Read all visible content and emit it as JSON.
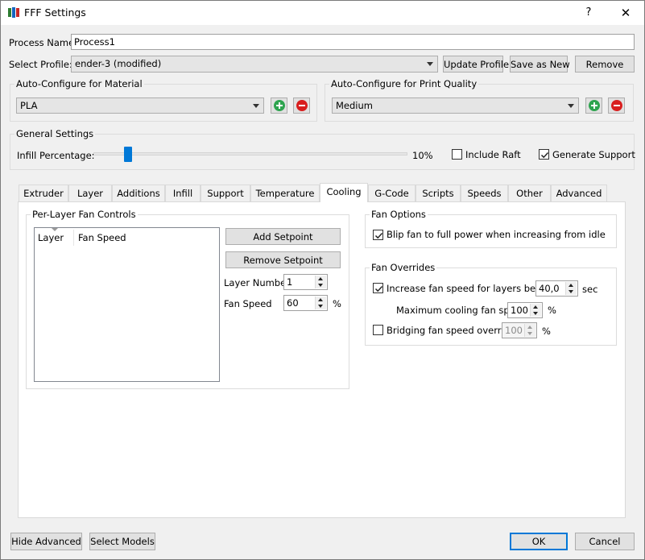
{
  "window": {
    "title": "FFF Settings",
    "help_glyph": "?",
    "close_glyph": "✕"
  },
  "process": {
    "name_label": "Process Name:",
    "name_value": "Process1"
  },
  "profile": {
    "label": "Select Profile:",
    "value": "ender-3 (modified)",
    "update_label": "Update Profile",
    "save_as_new_label": "Save as New",
    "remove_label": "Remove"
  },
  "material": {
    "title": "Auto-Configure for Material",
    "value": "PLA"
  },
  "quality": {
    "title": "Auto-Configure for Print Quality",
    "value": "Medium"
  },
  "general": {
    "title": "General Settings",
    "infill_label": "Infill Percentage:",
    "infill_value": "10%",
    "infill_fraction": 0.1,
    "include_raft_label": "Include Raft",
    "include_raft_checked": false,
    "generate_support_label": "Generate Support",
    "generate_support_checked": true
  },
  "tabs": [
    {
      "label": "Extruder",
      "active": false
    },
    {
      "label": "Layer",
      "active": false
    },
    {
      "label": "Additions",
      "active": false
    },
    {
      "label": "Infill",
      "active": false
    },
    {
      "label": "Support",
      "active": false
    },
    {
      "label": "Temperature",
      "active": false
    },
    {
      "label": "Cooling",
      "active": true
    },
    {
      "label": "G-Code",
      "active": false
    },
    {
      "label": "Scripts",
      "active": false
    },
    {
      "label": "Speeds",
      "active": false
    },
    {
      "label": "Other",
      "active": false
    },
    {
      "label": "Advanced",
      "active": false
    }
  ],
  "cooling": {
    "per_layer_title": "Per-Layer Fan Controls",
    "col_layer": "Layer",
    "col_fan_speed": "Fan Speed",
    "add_setpoint_label": "Add Setpoint",
    "remove_setpoint_label": "Remove Setpoint",
    "layer_number_label": "Layer Number",
    "layer_number_value": "1",
    "fan_speed_label": "Fan Speed",
    "fan_speed_value": "60",
    "fan_speed_unit": "%",
    "fan_options_title": "Fan Options",
    "blip_label": "Blip fan to full power when increasing from idle",
    "blip_checked": true,
    "fan_overrides_title": "Fan Overrides",
    "increase_label": "Increase fan speed for layers below",
    "increase_checked": true,
    "increase_value": "40,0",
    "increase_unit": "sec",
    "max_cooling_label": "Maximum cooling fan speed",
    "max_cooling_value": "100",
    "max_cooling_unit": "%",
    "bridging_label": "Bridging fan speed override",
    "bridging_checked": false,
    "bridging_value": "100",
    "bridging_unit": "%"
  },
  "footer": {
    "hide_advanced_label": "Hide Advanced",
    "select_models_label": "Select Models",
    "ok_label": "OK",
    "cancel_label": "Cancel"
  },
  "colors": {
    "accent": "#0078d7",
    "add_icon": "#2ea44f",
    "remove_icon": "#d81e1e"
  }
}
